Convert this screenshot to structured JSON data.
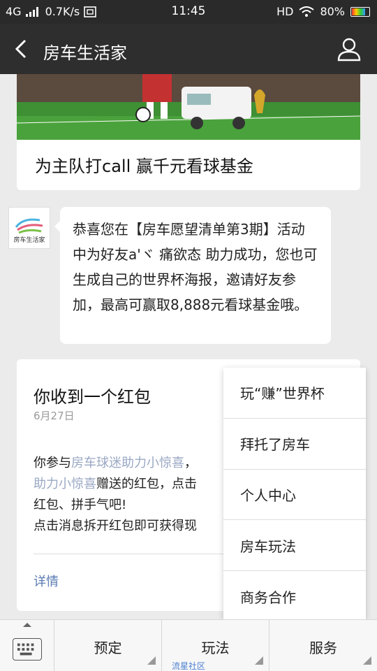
{
  "status_bar": {
    "network": "4G",
    "speed": "0.7K/s",
    "time": "11:45",
    "hd": "HD",
    "battery": "80%"
  },
  "header": {
    "title": "房车生活家",
    "back_icon": "chevron-left-icon",
    "profile_icon": "person-icon"
  },
  "article_card": {
    "headline": "为主队打call 赢千元看球基金"
  },
  "message": {
    "avatar_label": "房车生活家",
    "text": "恭喜您在【房车愿望清单第3期】活动中为好友a'ヾ 痛欲态 助力成功，您也可生成自己的世界杯海报，邀请好友参加，最高可赢取8,888元看球基金哦。"
  },
  "red_packet_card": {
    "title": "你收到一个红包",
    "date": "6月27日",
    "body_prefix": "你参与",
    "body_link": "房车球迷助力小惊喜",
    "body_line2_link": "助力小惊喜",
    "body_line2_text": "赠送的红包，点击",
    "body_line3": "红包、拼手气吧!",
    "body_line4": "点击消息拆开红包即可获得现",
    "detail": "详情"
  },
  "popup_menu": {
    "items": [
      {
        "label": "玩“赚”世界杯"
      },
      {
        "label": "拜托了房车"
      },
      {
        "label": "个人中心"
      },
      {
        "label": "房车玩法"
      },
      {
        "label": "商务合作"
      }
    ]
  },
  "bottom_bar": {
    "keyboard_icon": "keyboard-icon",
    "tabs": [
      {
        "label": "预定"
      },
      {
        "label": "玩法",
        "sub": "流星社区"
      },
      {
        "label": "服务"
      }
    ]
  }
}
